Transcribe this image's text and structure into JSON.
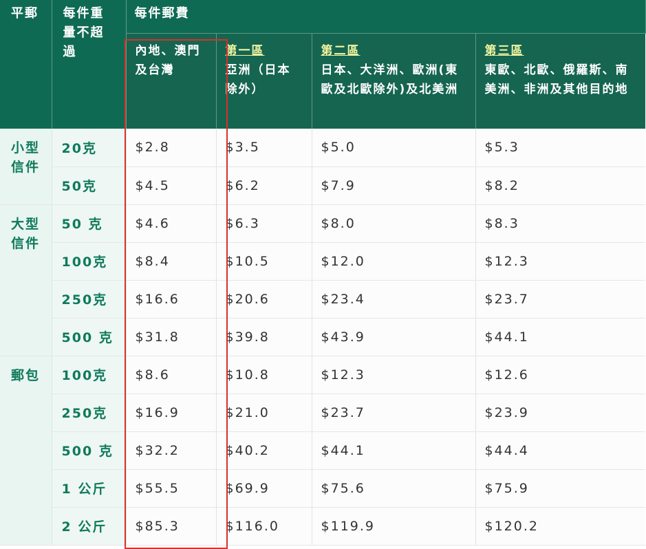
{
  "header": {
    "col_category": "平郵",
    "col_weight": "每件重量不超過",
    "col_fee": "每件郵費",
    "zones": [
      {
        "link": "",
        "text": "內地、澳門及台灣"
      },
      {
        "link": "第一區",
        "text": "亞洲（日本除外）"
      },
      {
        "link": "第二區",
        "text": "日本、大洋洲、歐洲(東歐及北歐除外)及北美洲"
      },
      {
        "link": "第三區",
        "text": "東歐、北歐、俄羅斯、南美洲、非洲及其他目的地"
      }
    ]
  },
  "groups": [
    {
      "category": "小型信件",
      "rows": [
        {
          "weight": "20克",
          "prices": [
            "$2.8",
            "$3.5",
            "$5.0",
            "$5.3"
          ]
        },
        {
          "weight": "50克",
          "prices": [
            "$4.5",
            "$6.2",
            "$7.9",
            "$8.2"
          ]
        }
      ]
    },
    {
      "category": "大型信件",
      "rows": [
        {
          "weight": "50 克",
          "prices": [
            "$4.6",
            "$6.3",
            "$8.0",
            "$8.3"
          ]
        },
        {
          "weight": "100克",
          "prices": [
            "$8.4",
            "$10.5",
            "$12.0",
            "$12.3"
          ]
        },
        {
          "weight": "250克",
          "prices": [
            "$16.6",
            "$20.6",
            "$23.4",
            "$23.7"
          ]
        },
        {
          "weight": "500 克",
          "prices": [
            "$31.8",
            "$39.8",
            "$43.9",
            "$44.1"
          ]
        }
      ]
    },
    {
      "category": "郵包",
      "rows": [
        {
          "weight": "100克",
          "prices": [
            "$8.6",
            "$10.8",
            "$12.3",
            "$12.6"
          ]
        },
        {
          "weight": "250克",
          "prices": [
            "$16.9",
            "$21.0",
            "$23.7",
            "$23.9"
          ]
        },
        {
          "weight": "500 克",
          "prices": [
            "$32.2",
            "$40.2",
            "$44.1",
            "$44.4"
          ]
        },
        {
          "weight": "1 公斤",
          "prices": [
            "$55.5",
            "$69.9",
            "$75.6",
            "$75.9"
          ]
        },
        {
          "weight": "2 公斤",
          "prices": [
            "$85.3",
            "$116.0",
            "$119.9",
            "$120.2"
          ]
        }
      ]
    }
  ],
  "colors": {
    "header_dark": "#0f6a53",
    "header_zone": "#156550",
    "zone_link": "#f2f5a1",
    "category_text": "#0f7a5b",
    "highlight_border": "#d9302c"
  }
}
